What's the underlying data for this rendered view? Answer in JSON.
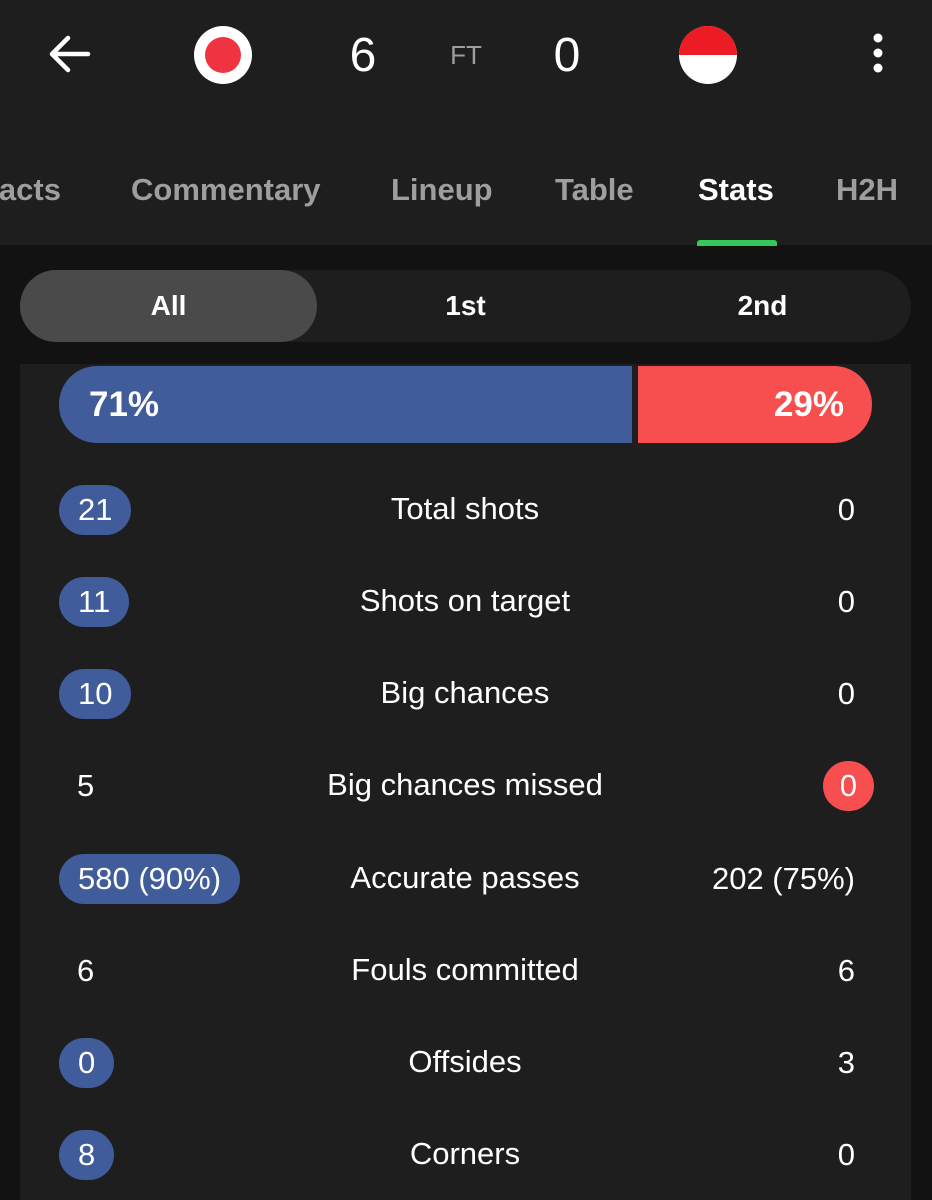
{
  "match": {
    "home_score": "6",
    "away_score": "0",
    "status": "FT"
  },
  "icons": {
    "back": "arrow-left-icon",
    "more": "more-vertical-icon"
  },
  "colors": {
    "home_team": "#415c9b",
    "away_team": "#f74e50",
    "active_tab_indicator": "#34c759",
    "background": "#121212",
    "card": "#1e1e1e"
  },
  "tabs": [
    {
      "label": "Facts",
      "active": false
    },
    {
      "label": "Commentary",
      "active": false
    },
    {
      "label": "Lineup",
      "active": false
    },
    {
      "label": "Table",
      "active": false
    },
    {
      "label": "Stats",
      "active": true
    },
    {
      "label": "H2H",
      "active": false
    }
  ],
  "periods": [
    {
      "label": "All",
      "selected": true
    },
    {
      "label": "1st",
      "selected": false
    },
    {
      "label": "2nd",
      "selected": false
    }
  ],
  "possession": {
    "home_label": "71%",
    "away_label": "29%",
    "home_percent": 71,
    "away_percent": 29
  },
  "stats": [
    {
      "label": "Total shots",
      "home": "21",
      "away": "0",
      "leader": "home"
    },
    {
      "label": "Shots on target",
      "home": "11",
      "away": "0",
      "leader": "home"
    },
    {
      "label": "Big chances",
      "home": "10",
      "away": "0",
      "leader": "home"
    },
    {
      "label": "Big chances missed",
      "home": "5",
      "away": "0",
      "leader": "away"
    },
    {
      "label": "Accurate passes",
      "home": "580 (90%)",
      "away": "202 (75%)",
      "leader": "home"
    },
    {
      "label": "Fouls committed",
      "home": "6",
      "away": "6",
      "leader": "none"
    },
    {
      "label": "Offsides",
      "home": "0",
      "away": "3",
      "leader": "home"
    },
    {
      "label": "Corners",
      "home": "8",
      "away": "0",
      "leader": "home"
    }
  ]
}
